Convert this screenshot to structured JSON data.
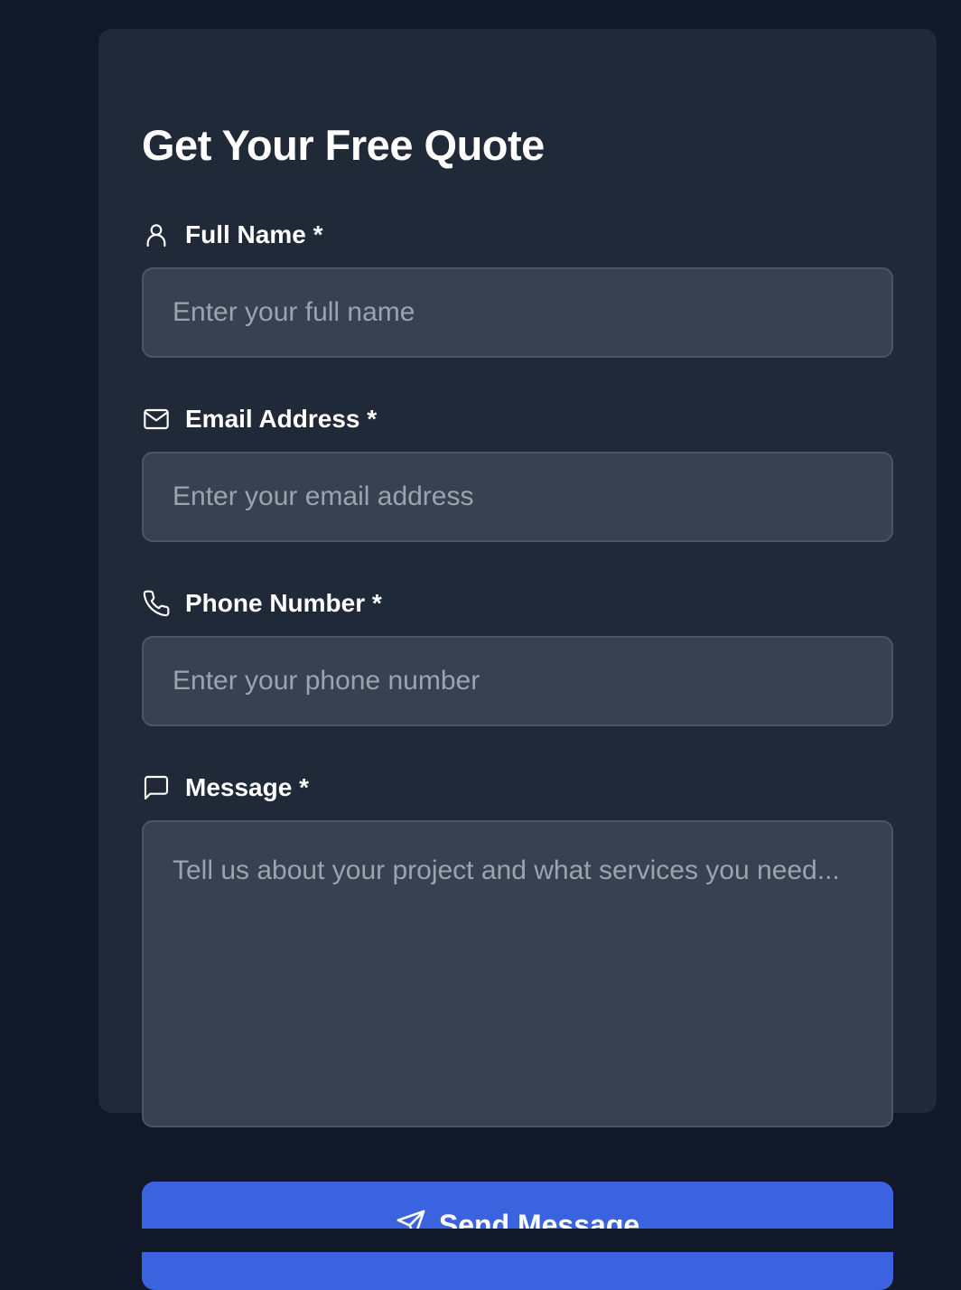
{
  "form": {
    "title": "Get Your Free Quote",
    "fields": [
      {
        "label": "Full Name *",
        "placeholder": "Enter your full name",
        "value": "",
        "icon": "user-icon"
      },
      {
        "label": "Email Address *",
        "placeholder": "Enter your email address",
        "value": "",
        "icon": "mail-icon"
      },
      {
        "label": "Phone Number *",
        "placeholder": "Enter your phone number",
        "value": "",
        "icon": "phone-icon"
      },
      {
        "label": "Message *",
        "placeholder": "Tell us about your project and what services you need...",
        "value": "",
        "icon": "message-square-icon"
      }
    ],
    "submit_label": "Send Message",
    "submit_icon": "send-icon"
  },
  "colors": {
    "page_background": "#111827",
    "card_background": "#1f2937",
    "input_background": "#374151",
    "input_border": "#4b5563",
    "placeholder": "#9ca3af",
    "accent": "#3b63e0",
    "text": "#ffffff"
  }
}
